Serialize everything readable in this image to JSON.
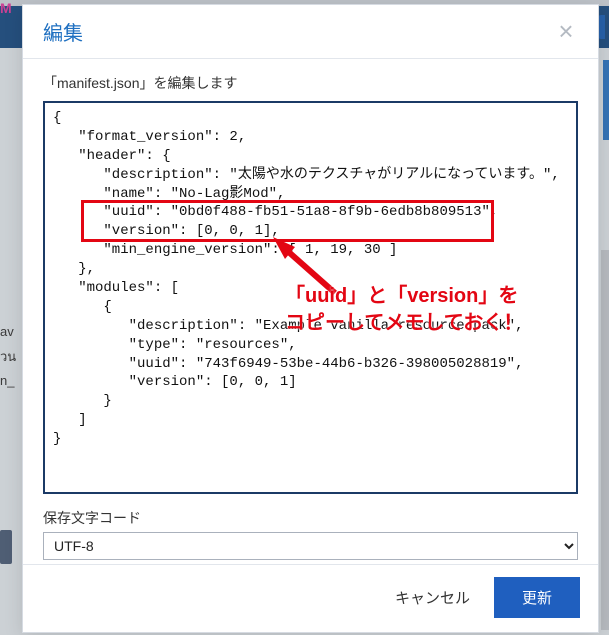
{
  "bg": {
    "logo": "M",
    "left_lines": [
      "av",
      "วน",
      "n_"
    ]
  },
  "modal": {
    "title": "編集",
    "subtitle": "「manifest.json」を編集します",
    "editor_text": "{\n   \"format_version\": 2,\n   \"header\": {\n      \"description\": \"太陽や水のテクスチャがリアルになっています。\",\n      \"name\": \"No-Lag影Mod\",\n      \"uuid\": \"0bd0f488-fb51-51a8-8f9b-6edb8b809513\",\n      \"version\": [0, 0, 1],\n      \"min_engine_version\": [ 1, 19, 30 ]\n   },\n   \"modules\": [\n      {\n         \"description\": \"Example vanilla resource pack\",\n         \"type\": \"resources\",\n         \"uuid\": \"743f6949-53be-44b6-b326-398005028819\",\n         \"version\": [0, 0, 1]\n      }\n   ]\n}",
    "encoding_label": "保存文字コード",
    "encoding_value": "UTF-8",
    "encoding_options": [
      "UTF-8"
    ],
    "cancel_label": "キャンセル",
    "update_label": "更新"
  },
  "annotation": {
    "line1": "「uuid」と「version」を",
    "line2": "コピーしてメモしておく！"
  },
  "colors": {
    "accent": "#1f70c1",
    "primary_btn": "#1f5fbf",
    "highlight": "#e30613",
    "border_dark": "#1b3a66"
  }
}
